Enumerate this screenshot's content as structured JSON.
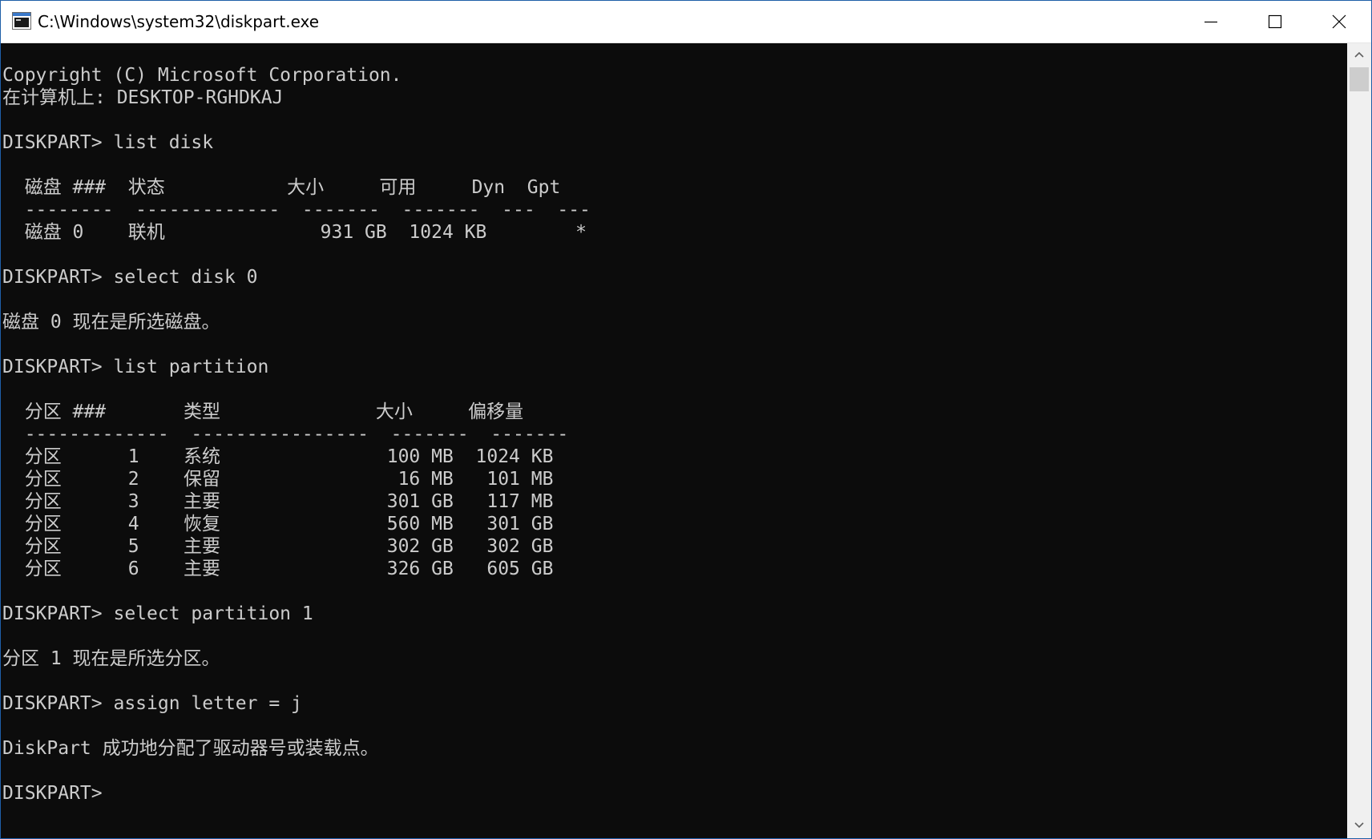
{
  "window": {
    "title": "C:\\Windows\\system32\\diskpart.exe",
    "icon": "console-window-icon"
  },
  "titlebar_buttons": {
    "minimize_icon": "minimize-icon",
    "maximize_icon": "maximize-icon",
    "close_icon": "close-icon"
  },
  "console": {
    "background": "#0c0c0c",
    "foreground": "#cccccc",
    "lines": [
      "Copyright (C) Microsoft Corporation.",
      "在计算机上: DESKTOP-RGHDKAJ",
      "",
      "DISKPART> list disk",
      "",
      "  磁盘 ###  状态           大小     可用     Dyn  Gpt",
      "  --------  -------------  -------  -------  ---  ---",
      "  磁盘 0    联机              931 GB  1024 KB        *",
      "",
      "DISKPART> select disk 0",
      "",
      "磁盘 0 现在是所选磁盘。",
      "",
      "DISKPART> list partition",
      "",
      "  分区 ###       类型              大小     偏移量",
      "  -------------  ----------------  -------  -------",
      "  分区      1    系统               100 MB  1024 KB",
      "  分区      2    保留                16 MB   101 MB",
      "  分区      3    主要               301 GB   117 MB",
      "  分区      4    恢复               560 MB   301 GB",
      "  分区      5    主要               302 GB   302 GB",
      "  分区      6    主要               326 GB   605 GB",
      "",
      "DISKPART> select partition 1",
      "",
      "分区 1 现在是所选分区。",
      "",
      "DISKPART> assign letter = j",
      "",
      "DiskPart 成功地分配了驱动器号或装载点。",
      "",
      "DISKPART>"
    ]
  },
  "scrollbar": {
    "up_icon": "scroll-up-arrow-icon",
    "down_icon": "scroll-down-arrow-icon"
  }
}
